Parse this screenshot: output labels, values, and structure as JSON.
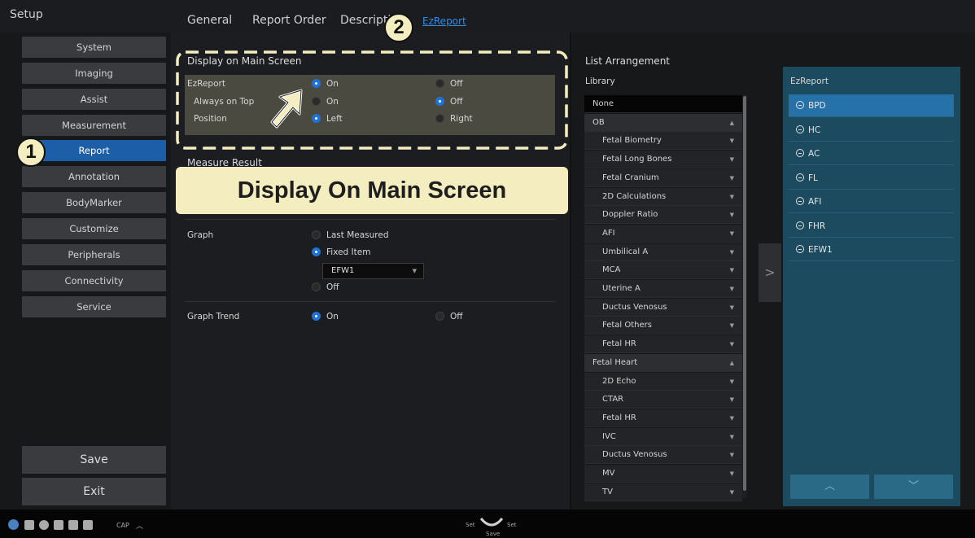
{
  "window": {
    "title": "Setup"
  },
  "tabs": [
    {
      "label": "General",
      "active": false
    },
    {
      "label": "Report Order",
      "active": false
    },
    {
      "label": "Descripti",
      "active": false
    },
    {
      "label": "EzReport",
      "active": true
    }
  ],
  "sidebar": {
    "items": [
      {
        "label": "System"
      },
      {
        "label": "Imaging"
      },
      {
        "label": "Assist"
      },
      {
        "label": "Measurement"
      },
      {
        "label": "Report",
        "active": true
      },
      {
        "label": "Annotation"
      },
      {
        "label": "BodyMarker"
      },
      {
        "label": "Customize"
      },
      {
        "label": "Peripherals"
      },
      {
        "label": "Connectivity"
      },
      {
        "label": "Service"
      }
    ],
    "save_label": "Save",
    "exit_label": "Exit"
  },
  "display_main": {
    "title": "Display on Main Screen",
    "rows": [
      {
        "label": "EzReport",
        "opt1": "On",
        "opt2": "Off",
        "selected": 1
      },
      {
        "label": "Always on Top",
        "opt1": "On",
        "opt2": "Off",
        "selected": 2
      },
      {
        "label": "Position",
        "opt1": "Left",
        "opt2": "Right",
        "selected": 1
      }
    ]
  },
  "measure_result": {
    "title": "Measure Result",
    "tooltip": "Display On Main Screen",
    "graph_label": "Graph",
    "graph_options": [
      "Last Measured",
      "Fixed Item",
      "Off"
    ],
    "graph_selected": "Fixed Item",
    "fixed_item_value": "EFW1",
    "trend_label": "Graph Trend",
    "trend_on": "On",
    "trend_off": "Off",
    "trend_selected": "On"
  },
  "list_arrangement": {
    "title": "List Arrangement",
    "library_label": "Library",
    "library": [
      {
        "label": "None",
        "kind": "none"
      },
      {
        "label": "OB",
        "kind": "cat",
        "chev": "▲"
      },
      {
        "label": "Fetal Biometry",
        "kind": "item",
        "chev": "▼"
      },
      {
        "label": "Fetal Long Bones",
        "kind": "item",
        "chev": "▼"
      },
      {
        "label": "Fetal Cranium",
        "kind": "item",
        "chev": "▼"
      },
      {
        "label": "2D Calculations",
        "kind": "item",
        "chev": "▼"
      },
      {
        "label": "Doppler Ratio",
        "kind": "item",
        "chev": "▼"
      },
      {
        "label": "AFI",
        "kind": "item",
        "chev": "▼"
      },
      {
        "label": "Umbilical A",
        "kind": "item",
        "chev": "▼"
      },
      {
        "label": "MCA",
        "kind": "item",
        "chev": "▼"
      },
      {
        "label": "Uterine A",
        "kind": "item",
        "chev": "▼"
      },
      {
        "label": "Ductus Venosus",
        "kind": "item",
        "chev": "▼"
      },
      {
        "label": "Fetal Others",
        "kind": "item",
        "chev": "▼"
      },
      {
        "label": "Fetal HR",
        "kind": "item",
        "chev": "▼"
      },
      {
        "label": "Fetal Heart",
        "kind": "cat",
        "chev": "▲"
      },
      {
        "label": "2D Echo",
        "kind": "item",
        "chev": "▼"
      },
      {
        "label": "CTAR",
        "kind": "item",
        "chev": "▼"
      },
      {
        "label": "Fetal HR",
        "kind": "item",
        "chev": "▼"
      },
      {
        "label": "IVC",
        "kind": "item",
        "chev": "▼"
      },
      {
        "label": "Ductus Venosus",
        "kind": "item",
        "chev": "▼"
      },
      {
        "label": "MV",
        "kind": "item",
        "chev": "▼"
      },
      {
        "label": "TV",
        "kind": "item",
        "chev": "▼"
      }
    ],
    "ezreport_label": "EzReport",
    "ezreport_items": [
      "BPD",
      "HC",
      "AC",
      "FL",
      "AFI",
      "FHR",
      "EFW1"
    ],
    "move_glyph": ">",
    "up_glyph": "︿",
    "down_glyph": "﹀"
  },
  "statusbar": {
    "cap_label": "CAP",
    "set_left": "Set",
    "set_right": "Set",
    "save_small": "Save"
  },
  "badges": {
    "one": "1",
    "two": "2"
  },
  "colors": {
    "accent": "#1f73d6",
    "tooltip_bg": "#f3edbf",
    "ez_panel": "#1c4a5f"
  }
}
